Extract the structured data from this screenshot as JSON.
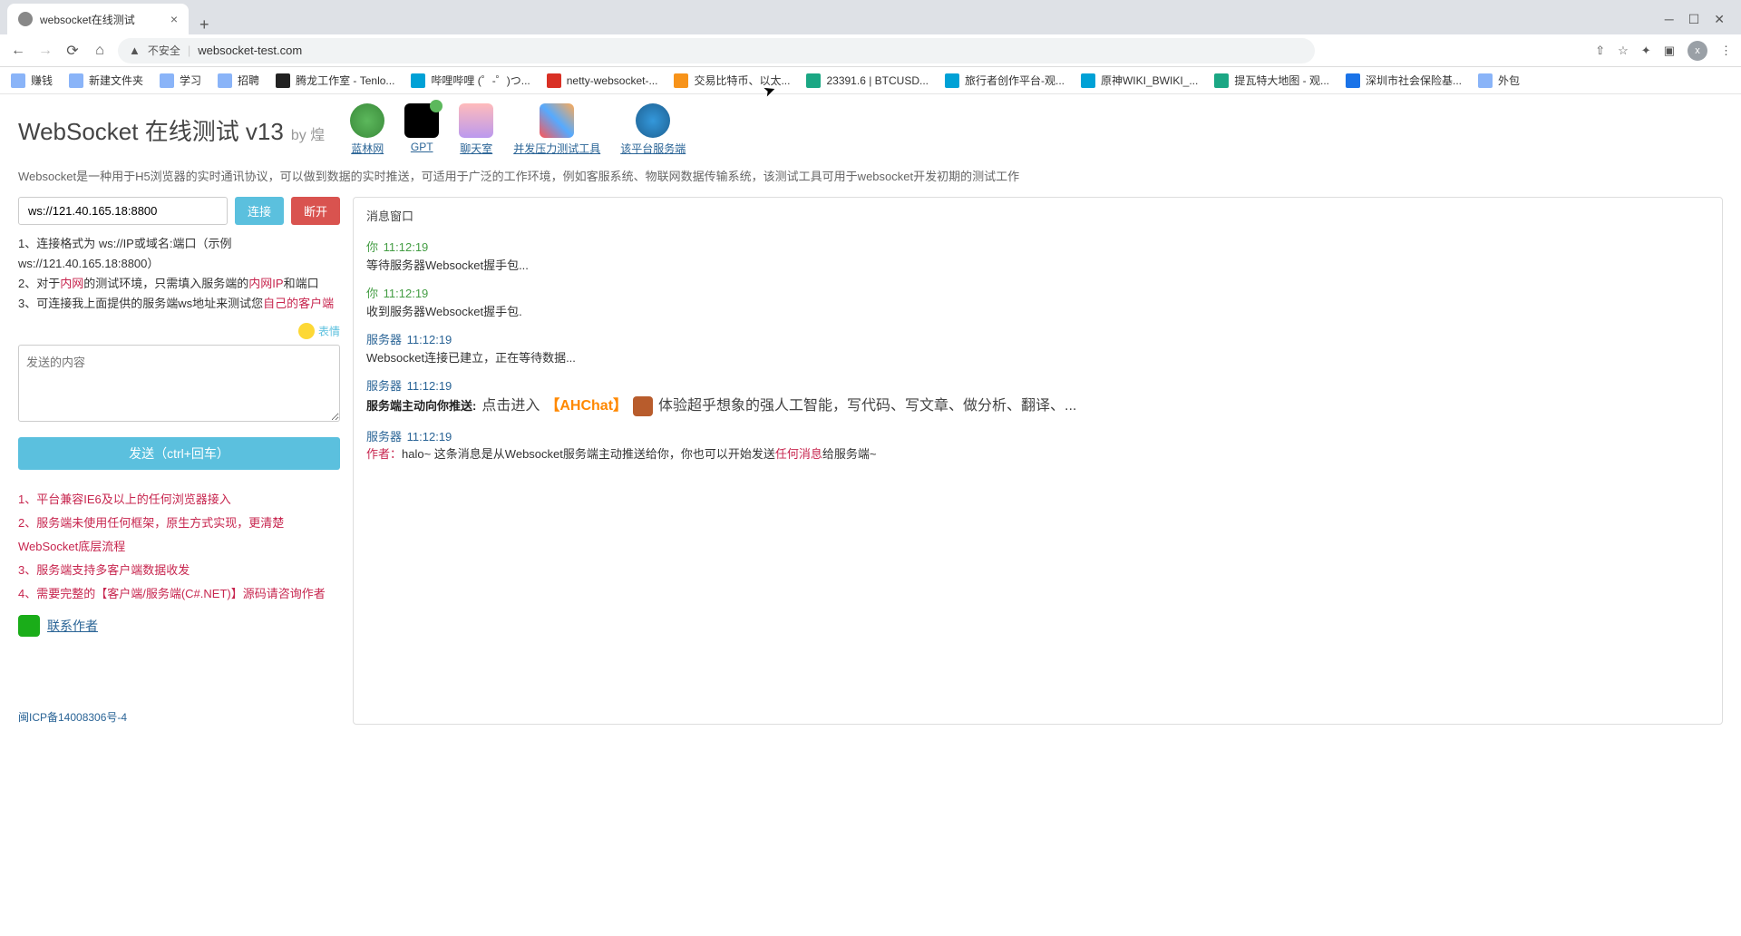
{
  "browser": {
    "tab_title": "websocket在线测试",
    "security_text": "不安全",
    "url": "websocket-test.com",
    "bookmarks": [
      {
        "label": "赚钱",
        "cls": "bm-folder"
      },
      {
        "label": "新建文件夹",
        "cls": "bm-folder"
      },
      {
        "label": "学习",
        "cls": "bm-folder"
      },
      {
        "label": "招聘",
        "cls": "bm-folder"
      },
      {
        "label": "腾龙工作室 - Tenlo...",
        "cls": "bm-dk"
      },
      {
        "label": "哔哩哔哩 (゜-゜)つ...",
        "cls": "bm-bili"
      },
      {
        "label": "netty-websocket-...",
        "cls": "bm-red"
      },
      {
        "label": "交易比特币、以太...",
        "cls": "bm-yel"
      },
      {
        "label": "23391.6 | BTCUSD...",
        "cls": "bm-grn"
      },
      {
        "label": "旅行者创作平台-观...",
        "cls": "bm-bili"
      },
      {
        "label": "原神WIKI_BWIKI_...",
        "cls": "bm-bili"
      },
      {
        "label": "提瓦特大地图 - 观...",
        "cls": "bm-grn"
      },
      {
        "label": "深圳市社会保险基...",
        "cls": "bm-blu"
      },
      {
        "label": "外包",
        "cls": "bm-folder"
      }
    ]
  },
  "header": {
    "title": "WebSocket 在线测试 v13",
    "by": "by 煌",
    "links": [
      {
        "label": "蓝林网",
        "ic": "ic-green"
      },
      {
        "label": "GPT",
        "ic": "ic-gpt"
      },
      {
        "label": "聊天室",
        "ic": "ic-ppl"
      },
      {
        "label": "并发压力测试工具",
        "ic": "ic-tool"
      },
      {
        "label": "该平台服务端",
        "ic": "ic-globe"
      }
    ],
    "desc": "Websocket是一种用于H5浏览器的实时通讯协议，可以做到数据的实时推送，可适用于广泛的工作环境，例如客服系统、物联网数据传输系统，该测试工具可用于websocket开发初期的测试工作"
  },
  "left": {
    "ws_url": "ws://121.40.165.18:8800",
    "connect": "连接",
    "disconnect": "断开",
    "instr1a": "1、连接格式为 ws://IP或域名:端口（示例ws://121.40.165.18:8800）",
    "instr2a": "2、对于",
    "instr2b": "内网",
    "instr2c": "的测试环境，只需填入服务端的",
    "instr2d": "内网IP",
    "instr2e": "和端口",
    "instr3a": "3、可连接我上面提供的服务端ws地址来测试您",
    "instr3b": "自己的客户端",
    "emoji_label": "表情",
    "msg_placeholder": "发送的内容",
    "send": "发送（ctrl+回车）",
    "notes": [
      "1、平台兼容IE6及以上的任何浏览器接入",
      "2、服务端未使用任何框架，原生方式实现，更清楚WebSocket底层流程",
      "3、服务端支持多客户端数据收发",
      "4、需要完整的【客户端/服务端(C#.NET)】源码请咨询作者"
    ],
    "contact": "联系作者",
    "icp": "闽ICP备14008306号-4"
  },
  "right": {
    "header": "消息窗口",
    "messages": [
      {
        "from": "你",
        "cls": "from-you",
        "time": "11:12:19",
        "body": "等待服务器Websocket握手包..."
      },
      {
        "from": "你",
        "cls": "from-you",
        "time": "11:12:19",
        "body": "收到服务器Websocket握手包."
      },
      {
        "from": "服务器",
        "cls": "from-srv",
        "time": "11:12:19",
        "body": "Websocket连接已建立，正在等待数据..."
      }
    ],
    "promo": {
      "from": "服务器",
      "time": "11:12:19",
      "prefix": "服务端主动向你推送:",
      "link_pre": "点击进入",
      "link_tag": "【AHChat】",
      "rest": "体验超乎想象的强人工智能，写代码、写文章、做分析、翻译、..."
    },
    "author_msg": {
      "from": "服务器",
      "time": "11:12:19",
      "pre": "作者：",
      "t1": "halo~ 这条消息是从Websocket服务端主动推送给你，你也可以开始发送",
      "hl": "任何消息",
      "t2": "给服务端~"
    }
  }
}
